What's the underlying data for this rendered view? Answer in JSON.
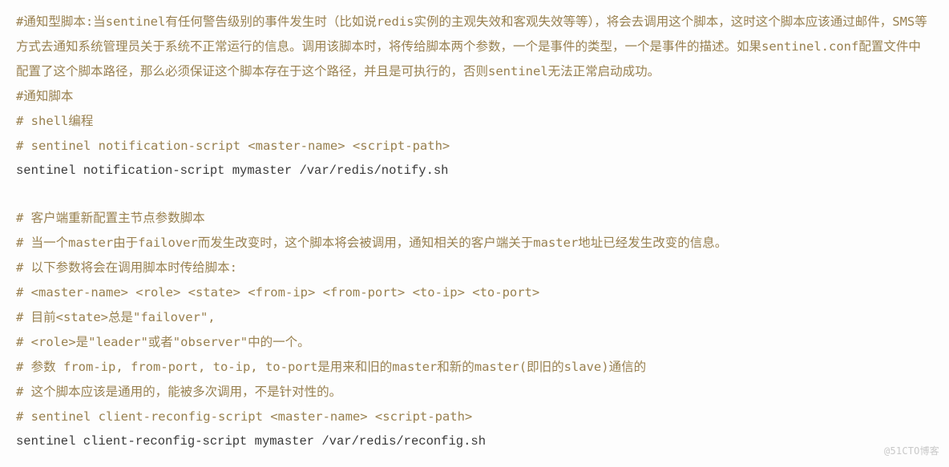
{
  "lines": [
    {
      "cls": "comment",
      "text": "#通知型脚本:当sentinel有任何警告级别的事件发生时（比如说redis实例的主观失效和客观失效等等），将会去调用这个脚本，这时这个脚本应该通过邮件，SMS等方式去通知系统管理员关于系统不正常运行的信息。调用该脚本时，将传给脚本两个参数，一个是事件的类型，一个是事件的描述。如果sentinel.conf配置文件中配置了这个脚本路径，那么必须保证这个脚本存在于这个路径，并且是可执行的，否则sentinel无法正常启动成功。"
    },
    {
      "cls": "comment",
      "text": "#通知脚本"
    },
    {
      "cls": "comment",
      "text": "# shell编程"
    },
    {
      "cls": "comment",
      "text": "# sentinel notification-script <master-name> <script-path>"
    },
    {
      "cls": "code",
      "text": "sentinel notification-script mymaster /var/redis/notify.sh"
    },
    {
      "cls": "blank",
      "text": ""
    },
    {
      "cls": "comment",
      "text": "# 客户端重新配置主节点参数脚本"
    },
    {
      "cls": "comment",
      "text": "# 当一个master由于failover而发生改变时，这个脚本将会被调用，通知相关的客户端关于master地址已经发生改变的信息。"
    },
    {
      "cls": "comment",
      "text": "# 以下参数将会在调用脚本时传给脚本:"
    },
    {
      "cls": "comment",
      "text": "# <master-name> <role> <state> <from-ip> <from-port> <to-ip> <to-port>"
    },
    {
      "cls": "comment",
      "text": "# 目前<state>总是\"failover\","
    },
    {
      "cls": "comment",
      "text": "# <role>是\"leader\"或者\"observer\"中的一个。"
    },
    {
      "cls": "comment",
      "text": "# 参数 from-ip, from-port, to-ip, to-port是用来和旧的master和新的master(即旧的slave)通信的"
    },
    {
      "cls": "comment",
      "text": "# 这个脚本应该是通用的，能被多次调用，不是针对性的。"
    },
    {
      "cls": "comment",
      "text": "# sentinel client-reconfig-script <master-name> <script-path>"
    },
    {
      "cls": "code",
      "text": "sentinel client-reconfig-script mymaster /var/redis/reconfig.sh"
    }
  ],
  "watermark": "@51CTO博客"
}
